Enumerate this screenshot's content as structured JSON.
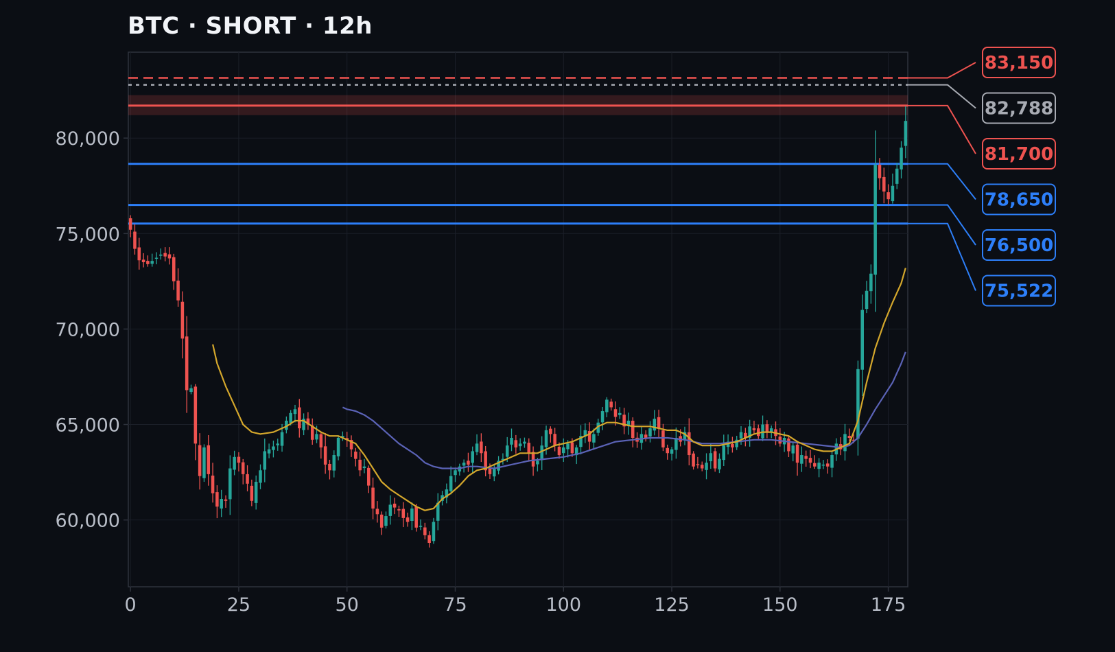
{
  "chart_data": {
    "type": "candlestick",
    "title": "BTC · SHORT · 12h",
    "x_ticks": [
      0,
      25,
      50,
      75,
      100,
      125,
      150,
      175
    ],
    "y_ticks": [
      60000,
      65000,
      70000,
      75000,
      80000
    ],
    "y_tick_labels": [
      "60,000",
      "65,000",
      "70,000",
      "75,000",
      "80,000"
    ],
    "xlim": [
      -0.5,
      179.5
    ],
    "ylim": [
      56500,
      84500
    ],
    "grid": true,
    "close_anchors": [
      [
        0,
        75200
      ],
      [
        1,
        74200
      ],
      [
        2,
        73600
      ],
      [
        4,
        73400
      ],
      [
        7,
        73900
      ],
      [
        9,
        73700
      ],
      [
        10,
        72500
      ],
      [
        11,
        71500
      ],
      [
        12,
        69500
      ],
      [
        13,
        66800
      ],
      [
        14,
        66900
      ],
      [
        15,
        64000
      ],
      [
        16,
        62300
      ],
      [
        17,
        63800
      ],
      [
        18,
        62400
      ],
      [
        19,
        61400
      ],
      [
        20,
        60700
      ],
      [
        21,
        61100
      ],
      [
        22,
        61000
      ],
      [
        23,
        62700
      ],
      [
        24,
        63300
      ],
      [
        25,
        63000
      ],
      [
        26,
        62400
      ],
      [
        27,
        61900
      ],
      [
        28,
        61000
      ],
      [
        29,
        62000
      ],
      [
        30,
        62600
      ],
      [
        31,
        63600
      ],
      [
        32,
        63700
      ],
      [
        34,
        64000
      ],
      [
        36,
        65200
      ],
      [
        37,
        65600
      ],
      [
        38,
        65800
      ],
      [
        39,
        64800
      ],
      [
        40,
        65300
      ],
      [
        41,
        65000
      ],
      [
        42,
        64200
      ],
      [
        43,
        64500
      ],
      [
        44,
        63800
      ],
      [
        45,
        62900
      ],
      [
        46,
        62600
      ],
      [
        47,
        63400
      ],
      [
        48,
        64300
      ],
      [
        49,
        64400
      ],
      [
        50,
        64200
      ],
      [
        51,
        63700
      ],
      [
        52,
        63200
      ],
      [
        53,
        62600
      ],
      [
        54,
        62800
      ],
      [
        55,
        61800
      ],
      [
        56,
        60600
      ],
      [
        57,
        60300
      ],
      [
        58,
        59600
      ],
      [
        59,
        60200
      ],
      [
        60,
        60800
      ],
      [
        62,
        60500
      ],
      [
        63,
        60100
      ],
      [
        64,
        59900
      ],
      [
        65,
        60600
      ],
      [
        66,
        59600
      ],
      [
        67,
        59700
      ],
      [
        68,
        59200
      ],
      [
        69,
        58800
      ],
      [
        70,
        59900
      ],
      [
        71,
        60900
      ],
      [
        72,
        61300
      ],
      [
        73,
        61600
      ],
      [
        74,
        62300
      ],
      [
        75,
        62600
      ],
      [
        77,
        63000
      ],
      [
        78,
        62900
      ],
      [
        79,
        63600
      ],
      [
        80,
        64000
      ],
      [
        81,
        63500
      ],
      [
        82,
        62600
      ],
      [
        83,
        62400
      ],
      [
        84,
        62700
      ],
      [
        85,
        63100
      ],
      [
        86,
        63200
      ],
      [
        87,
        63900
      ],
      [
        88,
        64300
      ],
      [
        89,
        63800
      ],
      [
        90,
        64000
      ],
      [
        91,
        64100
      ],
      [
        92,
        63500
      ],
      [
        93,
        62800
      ],
      [
        94,
        63100
      ],
      [
        95,
        63900
      ],
      [
        96,
        64700
      ],
      [
        97,
        64500
      ],
      [
        98,
        63900
      ],
      [
        99,
        63400
      ],
      [
        100,
        63800
      ],
      [
        101,
        64000
      ],
      [
        102,
        63500
      ],
      [
        103,
        63800
      ],
      [
        104,
        64400
      ],
      [
        105,
        64700
      ],
      [
        106,
        64100
      ],
      [
        107,
        64500
      ],
      [
        108,
        65100
      ],
      [
        109,
        65700
      ],
      [
        110,
        66300
      ],
      [
        111,
        65900
      ],
      [
        112,
        65400
      ],
      [
        113,
        65600
      ],
      [
        114,
        64900
      ],
      [
        115,
        65200
      ],
      [
        116,
        64300
      ],
      [
        117,
        64100
      ],
      [
        118,
        64500
      ],
      [
        119,
        64300
      ],
      [
        120,
        64800
      ],
      [
        121,
        65300
      ],
      [
        122,
        64800
      ],
      [
        123,
        63800
      ],
      [
        124,
        63500
      ],
      [
        125,
        63700
      ],
      [
        126,
        64300
      ],
      [
        127,
        64100
      ],
      [
        128,
        64600
      ],
      [
        129,
        63400
      ],
      [
        130,
        62800
      ],
      [
        131,
        62900
      ],
      [
        132,
        62700
      ],
      [
        133,
        63000
      ],
      [
        134,
        63500
      ],
      [
        135,
        62700
      ],
      [
        136,
        63200
      ],
      [
        137,
        63900
      ],
      [
        138,
        64100
      ],
      [
        139,
        63800
      ],
      [
        140,
        64200
      ],
      [
        141,
        64600
      ],
      [
        142,
        64300
      ],
      [
        143,
        64900
      ],
      [
        144,
        64700
      ],
      [
        145,
        64400
      ],
      [
        146,
        65000
      ],
      [
        147,
        64600
      ],
      [
        148,
        64800
      ],
      [
        149,
        64400
      ],
      [
        150,
        64000
      ],
      [
        151,
        64300
      ],
      [
        152,
        63600
      ],
      [
        153,
        63900
      ],
      [
        154,
        63000
      ],
      [
        155,
        63400
      ],
      [
        156,
        63200
      ],
      [
        157,
        63000
      ],
      [
        158,
        62800
      ],
      [
        159,
        63000
      ],
      [
        160,
        62900
      ],
      [
        161,
        62800
      ],
      [
        162,
        63400
      ],
      [
        163,
        64000
      ],
      [
        164,
        63700
      ],
      [
        165,
        64500
      ],
      [
        166,
        64300
      ],
      [
        167,
        64200
      ],
      [
        168,
        67900
      ],
      [
        169,
        71000
      ],
      [
        170,
        72000
      ],
      [
        171,
        72900
      ],
      [
        172,
        78600
      ],
      [
        173,
        77900
      ],
      [
        174,
        77200
      ],
      [
        175,
        76800
      ],
      [
        176,
        77500
      ],
      [
        177,
        78400
      ],
      [
        178,
        79500
      ],
      [
        179,
        80900
      ]
    ],
    "ma_fast": [
      [
        19,
        69200
      ],
      [
        20,
        68200
      ],
      [
        22,
        67000
      ],
      [
        24,
        66000
      ],
      [
        26,
        65000
      ],
      [
        28,
        64600
      ],
      [
        30,
        64500
      ],
      [
        33,
        64600
      ],
      [
        36,
        64900
      ],
      [
        38,
        65200
      ],
      [
        40,
        65200
      ],
      [
        42,
        64900
      ],
      [
        44,
        64600
      ],
      [
        46,
        64400
      ],
      [
        48,
        64400
      ],
      [
        50,
        64200
      ],
      [
        52,
        64000
      ],
      [
        54,
        63400
      ],
      [
        56,
        62700
      ],
      [
        58,
        62000
      ],
      [
        60,
        61600
      ],
      [
        62,
        61300
      ],
      [
        64,
        61000
      ],
      [
        66,
        60700
      ],
      [
        68,
        60500
      ],
      [
        70,
        60600
      ],
      [
        72,
        61100
      ],
      [
        74,
        61400
      ],
      [
        76,
        61800
      ],
      [
        78,
        62300
      ],
      [
        80,
        62600
      ],
      [
        82,
        62700
      ],
      [
        84,
        62900
      ],
      [
        86,
        63100
      ],
      [
        88,
        63300
      ],
      [
        90,
        63500
      ],
      [
        92,
        63500
      ],
      [
        94,
        63500
      ],
      [
        96,
        63700
      ],
      [
        98,
        63900
      ],
      [
        100,
        64000
      ],
      [
        102,
        64100
      ],
      [
        104,
        64300
      ],
      [
        106,
        64500
      ],
      [
        108,
        64900
      ],
      [
        110,
        65100
      ],
      [
        112,
        65100
      ],
      [
        114,
        65000
      ],
      [
        116,
        64900
      ],
      [
        118,
        64900
      ],
      [
        120,
        64900
      ],
      [
        122,
        64800
      ],
      [
        124,
        64700
      ],
      [
        126,
        64700
      ],
      [
        128,
        64500
      ],
      [
        130,
        64100
      ],
      [
        132,
        63900
      ],
      [
        134,
        63900
      ],
      [
        136,
        63900
      ],
      [
        138,
        64000
      ],
      [
        140,
        64100
      ],
      [
        142,
        64300
      ],
      [
        144,
        64500
      ],
      [
        146,
        64600
      ],
      [
        148,
        64600
      ],
      [
        150,
        64500
      ],
      [
        152,
        64400
      ],
      [
        154,
        64100
      ],
      [
        156,
        63900
      ],
      [
        158,
        63700
      ],
      [
        160,
        63600
      ],
      [
        162,
        63600
      ],
      [
        164,
        63800
      ],
      [
        166,
        64000
      ],
      [
        168,
        65200
      ],
      [
        170,
        67200
      ],
      [
        172,
        69000
      ],
      [
        174,
        70300
      ],
      [
        176,
        71400
      ],
      [
        178,
        72400
      ],
      [
        179,
        73200
      ]
    ],
    "ma_slow": [
      [
        49,
        65900
      ],
      [
        50,
        65800
      ],
      [
        52,
        65700
      ],
      [
        54,
        65500
      ],
      [
        56,
        65200
      ],
      [
        58,
        64800
      ],
      [
        60,
        64400
      ],
      [
        62,
        64000
      ],
      [
        64,
        63700
      ],
      [
        66,
        63400
      ],
      [
        68,
        63000
      ],
      [
        70,
        62800
      ],
      [
        72,
        62700
      ],
      [
        74,
        62700
      ],
      [
        76,
        62700
      ],
      [
        78,
        62800
      ],
      [
        80,
        62800
      ],
      [
        84,
        62700
      ],
      [
        88,
        62900
      ],
      [
        92,
        63100
      ],
      [
        96,
        63200
      ],
      [
        100,
        63300
      ],
      [
        104,
        63500
      ],
      [
        108,
        63800
      ],
      [
        112,
        64100
      ],
      [
        116,
        64200
      ],
      [
        120,
        64300
      ],
      [
        124,
        64300
      ],
      [
        128,
        64200
      ],
      [
        132,
        64000
      ],
      [
        136,
        64000
      ],
      [
        140,
        64100
      ],
      [
        144,
        64200
      ],
      [
        148,
        64200
      ],
      [
        152,
        64100
      ],
      [
        156,
        64000
      ],
      [
        160,
        63900
      ],
      [
        164,
        63800
      ],
      [
        166,
        63900
      ],
      [
        168,
        64300
      ],
      [
        170,
        65000
      ],
      [
        172,
        65800
      ],
      [
        174,
        66500
      ],
      [
        176,
        67200
      ],
      [
        178,
        68200
      ],
      [
        179,
        68800
      ]
    ],
    "levels": [
      {
        "value": 83150,
        "label": "83,150",
        "color": "#ef5350",
        "style": "dashed"
      },
      {
        "value": 82788,
        "label": "82,788",
        "color": "#a8abb3",
        "style": "dotted"
      },
      {
        "value": 81700,
        "label": "81,700",
        "color": "#ef5350",
        "style": "solid",
        "band": [
          81200,
          82250
        ]
      },
      {
        "value": 78650,
        "label": "78,650",
        "color": "#2d7ff9",
        "style": "solid"
      },
      {
        "value": 76500,
        "label": "76,500",
        "color": "#2d7ff9",
        "style": "solid"
      },
      {
        "value": 75522,
        "label": "75,522",
        "color": "#2d7ff9",
        "style": "solid"
      }
    ],
    "colors": {
      "background": "#0b0e14",
      "plot_border": "#2e323c",
      "grid": "#1b1f28",
      "up": "#26a69a",
      "down": "#ef5350",
      "ma_fast": "#d4a72c",
      "ma_slow": "#5b63b7",
      "tick_text": "#b9bec8",
      "title_text": "#f2f4f8",
      "label_bg": "#0b0e14"
    }
  }
}
